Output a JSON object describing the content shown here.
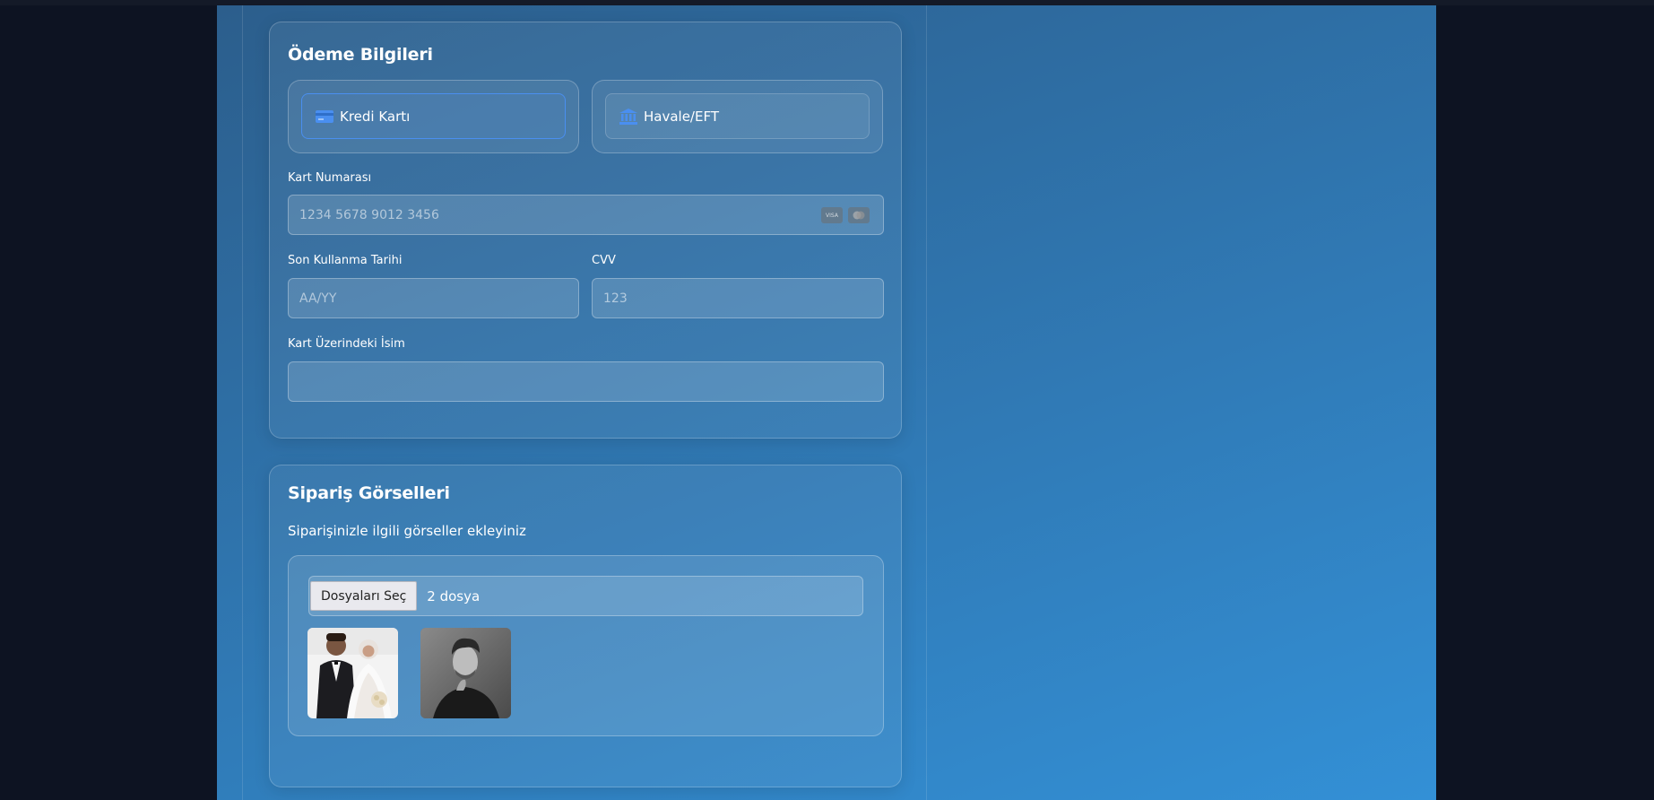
{
  "payment": {
    "title": "Ödeme Bilgileri",
    "methods": [
      {
        "label": "Kredi Kartı",
        "icon": "credit-card-icon",
        "selected": true
      },
      {
        "label": "Havale/EFT",
        "icon": "bank-icon",
        "selected": false
      }
    ],
    "card_number": {
      "label": "Kart Numarası",
      "placeholder": "1234 5678 9012 3456",
      "value": ""
    },
    "card_brands": [
      "VISA",
      "mastercard"
    ],
    "expiry": {
      "label": "Son Kullanma Tarihi",
      "placeholder": "AA/YY",
      "value": ""
    },
    "cvv": {
      "label": "CVV",
      "placeholder": "123",
      "value": ""
    },
    "name_on_card": {
      "label": "Kart Üzerindeki İsim",
      "placeholder": "",
      "value": ""
    }
  },
  "images": {
    "title": "Sipariş Görselleri",
    "subtitle": "Siparişinizle ilgili görseller ekleyiniz",
    "choose_button": "Dosyaları Seç",
    "file_count": "2 dosya",
    "thumbnails": [
      "wedding-couple-photo",
      "man-portrait-photo"
    ]
  },
  "colors": {
    "accent": "#4a8ff0",
    "gradient_start": "#2c5e8c",
    "gradient_end": "#3390d6",
    "page_bg": "#0d1322"
  }
}
